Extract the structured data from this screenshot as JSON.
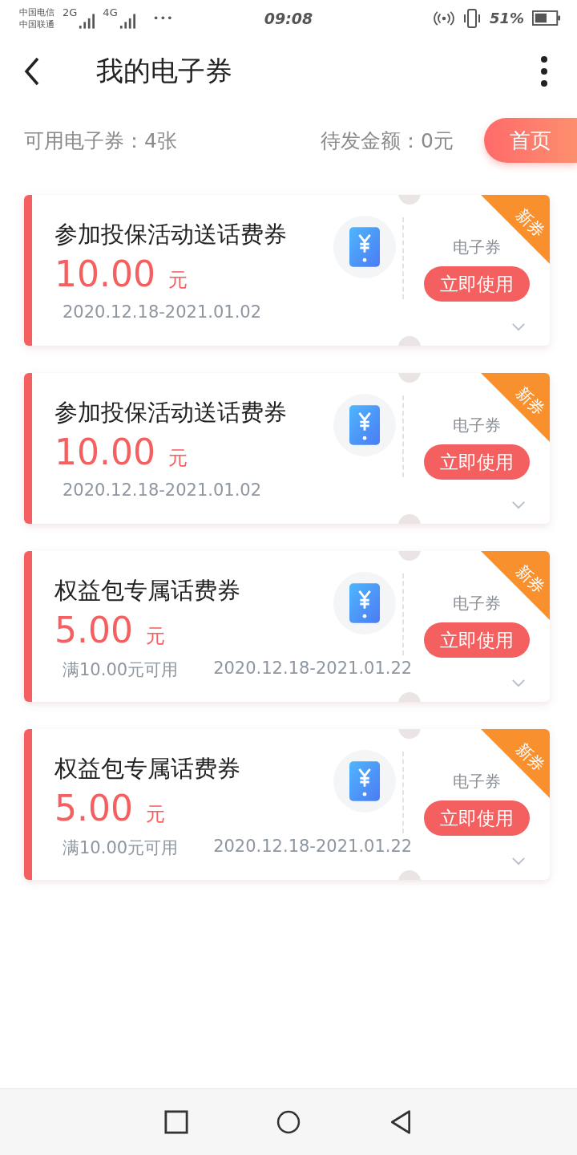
{
  "status_bar": {
    "carriers": [
      "中国电信",
      "中国联通"
    ],
    "networks": [
      "2G",
      "4G"
    ],
    "more": "•••",
    "time": "09:08",
    "battery": "51%"
  },
  "header": {
    "title": "我的电子券"
  },
  "summary": {
    "available": "可用电子券：4张",
    "pending": "待发金额：0元",
    "home_button": "首页"
  },
  "coupons": [
    {
      "title": "参加投保活动送话费券",
      "amount": "10.00",
      "unit": "元",
      "period": "2020.12.18-2021.01.02",
      "type": "电子券",
      "action": "立即使用",
      "badge": "新券"
    },
    {
      "title": "参加投保活动送话费券",
      "amount": "10.00",
      "unit": "元",
      "period": "2020.12.18-2021.01.02",
      "type": "电子券",
      "action": "立即使用",
      "badge": "新券"
    },
    {
      "title": "权益包专属话费券",
      "amount": "5.00",
      "unit": "元",
      "condition": "满10.00元可用",
      "period": "2020.12.18-2021.01.22",
      "type": "电子券",
      "action": "立即使用",
      "badge": "新券"
    },
    {
      "title": "权益包专属话费券",
      "amount": "5.00",
      "unit": "元",
      "condition": "满10.00元可用",
      "period": "2020.12.18-2021.01.22",
      "type": "电子券",
      "action": "立即使用",
      "badge": "新券"
    }
  ]
}
